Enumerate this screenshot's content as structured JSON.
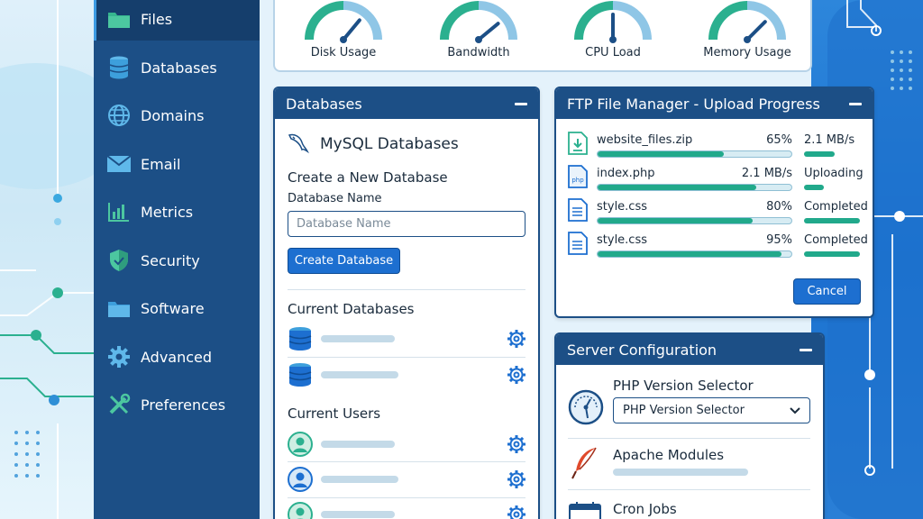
{
  "sidebar": {
    "items": [
      {
        "label": "Files",
        "icon": "folder-icon",
        "active": true
      },
      {
        "label": "Databases",
        "icon": "database-icon"
      },
      {
        "label": "Domains",
        "icon": "globe-icon"
      },
      {
        "label": "Email",
        "icon": "envelope-icon"
      },
      {
        "label": "Metrics",
        "icon": "bar-chart-icon"
      },
      {
        "label": "Security",
        "icon": "shield-icon"
      },
      {
        "label": "Software",
        "icon": "folder-icon"
      },
      {
        "label": "Advanced",
        "icon": "gear-icon"
      },
      {
        "label": "Preferences",
        "icon": "tools-icon"
      }
    ]
  },
  "gauges": [
    {
      "label": "Disk Usage",
      "level": 0.72
    },
    {
      "label": "Bandwidth",
      "level": 0.78
    },
    {
      "label": "CPU Load",
      "level": 0.5
    },
    {
      "label": "Memory Usage",
      "level": 0.75
    }
  ],
  "databases_panel": {
    "title": "Databases",
    "mysql_title": "MySQL Databases",
    "create_title": "Create a New Database",
    "field_label": "Database Name",
    "field_placeholder": "Database Name",
    "field_value": "",
    "create_button": "Create Database",
    "current_databases_title": "Current Databases",
    "current_users_title": "Current Users",
    "database_rows": 2,
    "user_rows": 3
  },
  "ftp_panel": {
    "title": "FTP File Manager - Upload Progress",
    "files": [
      {
        "name": "website_files.zip",
        "value": "65%",
        "status": "2.1 MB/s",
        "progress": 0.65,
        "icon": "zip-file-icon",
        "status_bar": 0.55
      },
      {
        "name": "index.php",
        "value": "2.1 MB/s",
        "status": "Uploading",
        "progress": 0.82,
        "icon": "php-file-icon",
        "status_bar": 0.35
      },
      {
        "name": "style.css",
        "value": "80%",
        "status": "Completed",
        "progress": 0.8,
        "icon": "css-file-icon",
        "status_bar": 1
      },
      {
        "name": "style.css",
        "value": "95%",
        "status": "Completed",
        "progress": 0.95,
        "icon": "css-file-icon",
        "status_bar": 1
      }
    ],
    "cancel_button": "Cancel"
  },
  "server_panel": {
    "title": "Server Configuration",
    "php_title": "PHP Version Selector",
    "php_select_value": "PHP Version Selector",
    "apache_title": "Apache Modules",
    "cron_title": "Cron Jobs"
  },
  "colors": {
    "sidebar": "#1c4f86",
    "accent": "#1d6fd0",
    "progress": "#21a98b",
    "gauge_green": "#2bb08f",
    "gauge_blue": "#8fc6e6"
  }
}
